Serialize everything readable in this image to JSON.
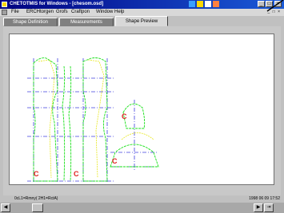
{
  "window": {
    "title": "CHETOTMIS for Windows - [chesom.osd]"
  },
  "menu": {
    "items": [
      "File",
      "ERCHtorgen",
      "Grofs",
      "Craftpon",
      "Window",
      "Help"
    ],
    "mdi_controls": "_ □ ×"
  },
  "tabs": [
    {
      "label": "Shape Definition",
      "active": false
    },
    {
      "label": "Measurements",
      "active": false
    },
    {
      "label": "Shape Preview",
      "active": true
    }
  ],
  "canvas": {
    "piece_marker": "C"
  },
  "status": {
    "left": "0cL1=Rmny(  2H1=RctA)",
    "right": "1998 06 09 17:52"
  },
  "colors": {
    "accent": "#000080",
    "cut_line": "#19e019",
    "seam_line": "#e8e820",
    "guide_line": "#4040e0",
    "marker": "#e02020"
  }
}
